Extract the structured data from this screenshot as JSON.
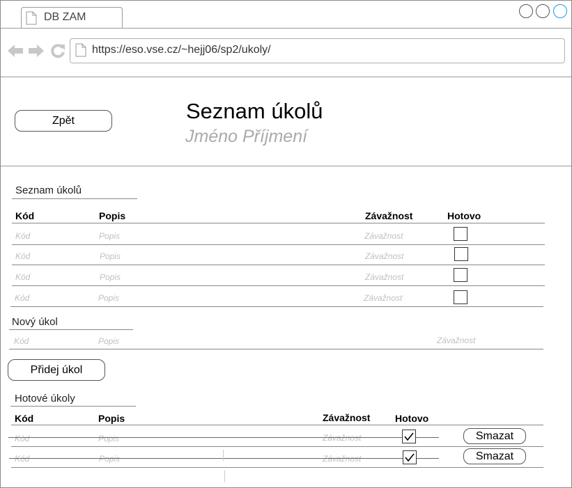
{
  "browser": {
    "tab_title": "DB ZAM",
    "url": "https://eso.vse.cz/~hejj06/sp2/ukoly/"
  },
  "header": {
    "back_label": "Zpět",
    "title": "Seznam úkolů",
    "subtitle": "Jméno Příjmení"
  },
  "tasks": {
    "section_title": "Seznam úkolů",
    "columns": [
      "Kód",
      "Popis",
      "Závažnost",
      "Hotovo"
    ],
    "rows": [
      {
        "code": "Kód",
        "description": "Popis",
        "severity": "Závažnost",
        "done": false
      },
      {
        "code": "Kód",
        "description": "Popis",
        "severity": "Závažnost",
        "done": false
      },
      {
        "code": "Kód",
        "description": "Popis",
        "severity": "Závažnost",
        "done": false
      },
      {
        "code": "Kód",
        "description": "Popis",
        "severity": "Závažnost",
        "done": false
      }
    ]
  },
  "new_task": {
    "section_title": "Nový úkol",
    "code_placeholder": "Kód",
    "description_placeholder": "Popis",
    "severity_placeholder": "Závažnost",
    "add_label": "Přidej úkol"
  },
  "done_tasks": {
    "section_title": "Hotové úkoly",
    "columns": [
      "Kód",
      "Popis",
      "Závažnost",
      "Hotovo"
    ],
    "rows": [
      {
        "code": "Kód",
        "description": "Popis",
        "severity": "Závažnost",
        "done": true,
        "delete_label": "Smazat"
      },
      {
        "code": "Kód",
        "description": "Popis",
        "severity": "Závažnost",
        "done": true,
        "delete_label": "Smazat"
      }
    ]
  },
  "colors": {
    "accent": "#1a9be0",
    "placeholder": "#c0c0c0"
  }
}
